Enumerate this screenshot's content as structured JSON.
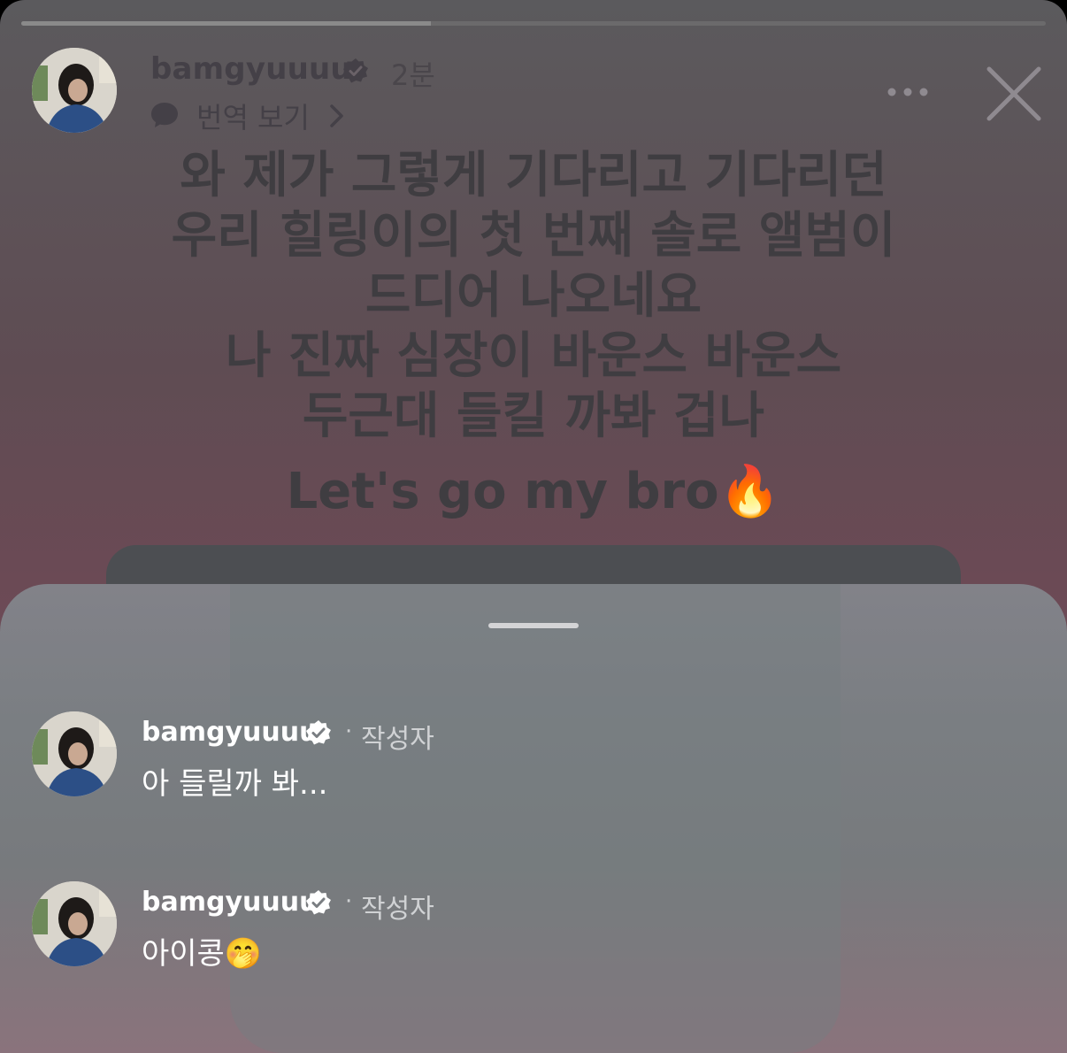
{
  "story": {
    "progress": 0.4,
    "header": {
      "username": "bamgyuuuu",
      "time": "2분",
      "translate_label": "번역 보기"
    },
    "text_lines": [
      "와 제가 그렇게 기다리고 기다리던",
      "우리 힐링이의 첫 번째 솔로 앨범이",
      "드디어 나오네요",
      "나 진짜 심장이 바운스 바운스",
      "두근대 들킬 까봐 겁나"
    ],
    "tagline": "Let's go my bro",
    "tagline_emoji": "🔥"
  },
  "comments": [
    {
      "username": "bamgyuuuu",
      "separator": "·",
      "author_label": "작성자",
      "text": "아 들릴까 봐..."
    },
    {
      "username": "bamgyuuuu",
      "separator": "·",
      "author_label": "작성자",
      "text": "아이콩",
      "emoji": "🤭"
    }
  ],
  "icons": {
    "verified": "verified-badge-icon",
    "translate": "speech-bubble-icon",
    "more": "more-horizontal-icon",
    "close": "close-icon"
  },
  "colors": {
    "verified_badge": "#ffffff",
    "sheet_background": "#7a7e82"
  }
}
